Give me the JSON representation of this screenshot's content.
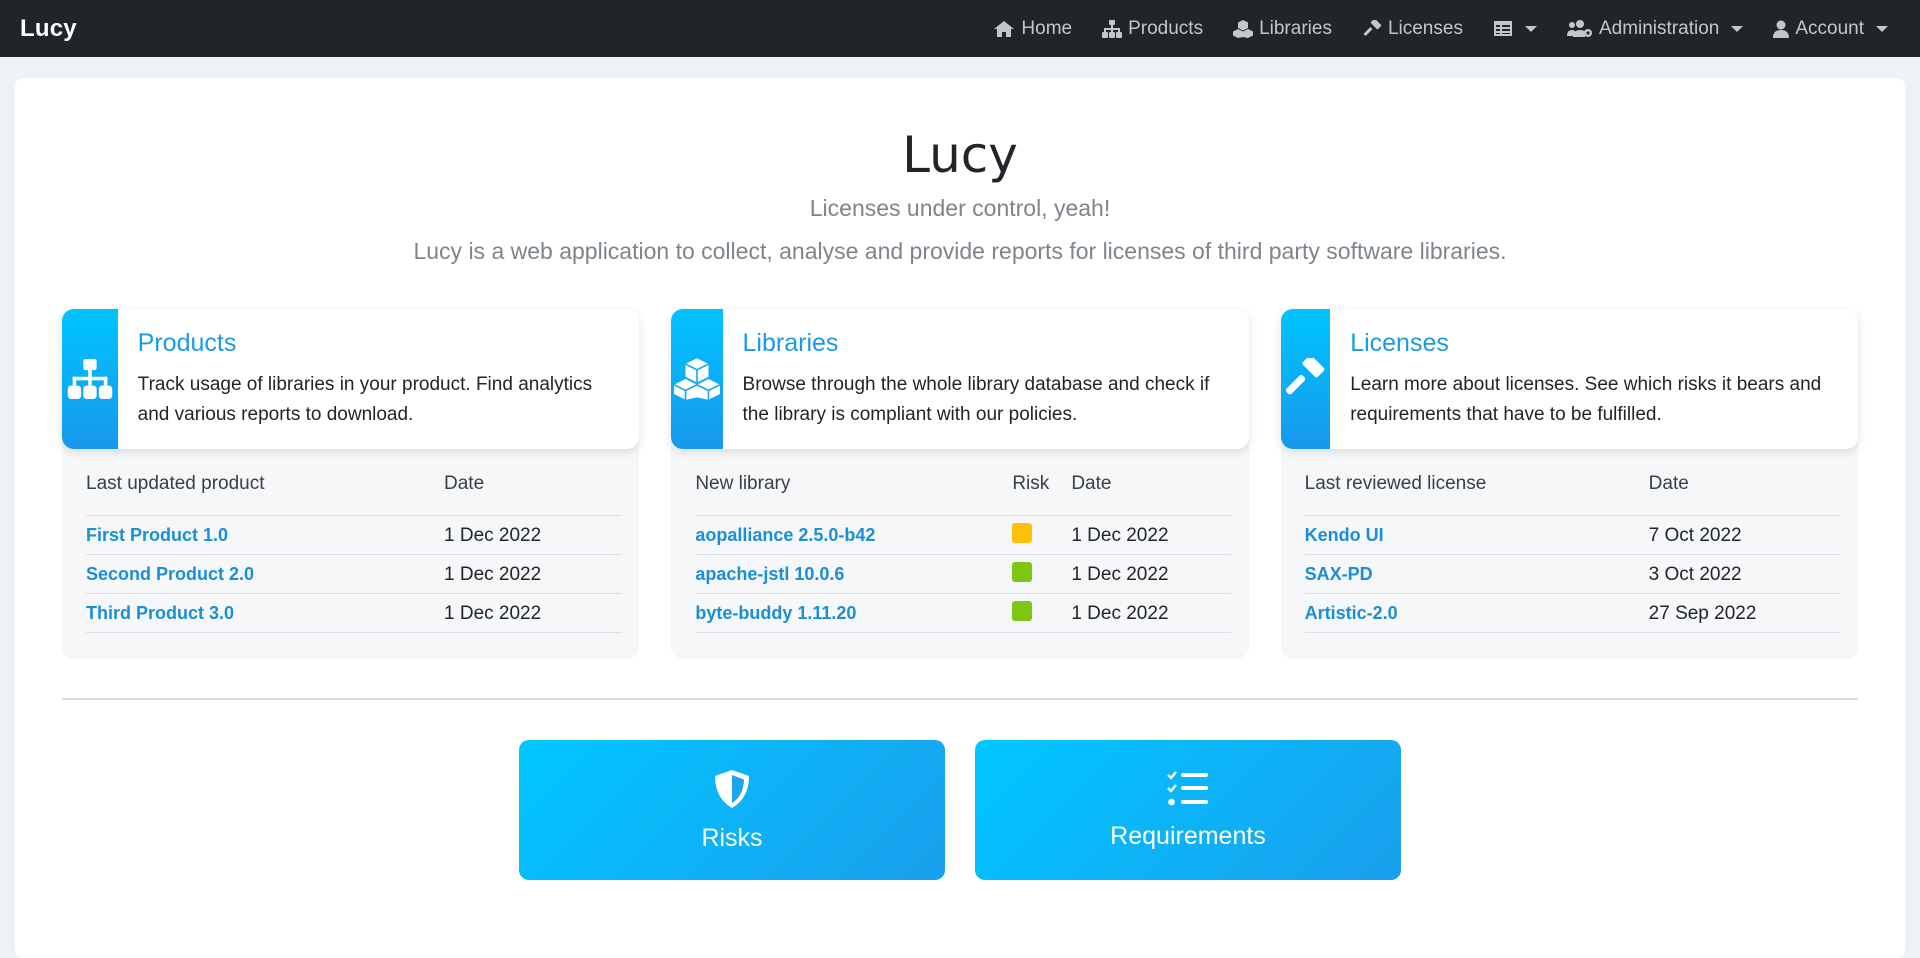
{
  "navbar": {
    "brand": "Lucy",
    "items": [
      {
        "label": "Home",
        "icon": "home-icon"
      },
      {
        "label": "Products",
        "icon": "sitemap-icon"
      },
      {
        "label": "Libraries",
        "icon": "cubes-icon"
      },
      {
        "label": "Licenses",
        "icon": "gavel-icon"
      },
      {
        "label": "",
        "icon": "table-icon",
        "dropdown": true
      },
      {
        "label": "Administration",
        "icon": "users-cog-icon",
        "dropdown": true
      },
      {
        "label": "Account",
        "icon": "user-icon",
        "dropdown": true
      }
    ]
  },
  "hero": {
    "title": "Lucy",
    "tagline": "Licenses under control, yeah!",
    "description": "Lucy is a web application to collect, analyse and provide reports for licenses of third party software libraries."
  },
  "cards": {
    "products": {
      "title": "Products",
      "description": "Track usage of libraries in your product. Find analytics and various reports to download.",
      "col1": "Last updated product",
      "col2": "Date",
      "rows": [
        {
          "name": "First Product 1.0",
          "date": "1 Dec 2022"
        },
        {
          "name": "Second Product 2.0",
          "date": "1 Dec 2022"
        },
        {
          "name": "Third Product 3.0",
          "date": "1 Dec 2022"
        }
      ]
    },
    "libraries": {
      "title": "Libraries",
      "description": "Browse through the whole library database and check if the library is compliant with our policies.",
      "col1": "New library",
      "col_risk": "Risk",
      "col2": "Date",
      "rows": [
        {
          "name": "aopalliance 2.5.0-b42",
          "risk_color": "#ffc107",
          "date": "1 Dec 2022"
        },
        {
          "name": "apache-jstl 10.0.6",
          "risk_color": "#7ec614",
          "date": "1 Dec 2022"
        },
        {
          "name": "byte-buddy 1.11.20",
          "risk_color": "#7ec614",
          "date": "1 Dec 2022"
        }
      ]
    },
    "licenses": {
      "title": "Licenses",
      "description": "Learn more about licenses. See which risks it bears and requirements that have to be fulfilled.",
      "col1": "Last reviewed license",
      "col2": "Date",
      "rows": [
        {
          "name": "Kendo UI",
          "date": "7 Oct 2022"
        },
        {
          "name": "SAX-PD",
          "date": "3 Oct 2022"
        },
        {
          "name": "Artistic-2.0",
          "date": "27 Sep 2022"
        }
      ]
    }
  },
  "buttons": {
    "risks": {
      "label": "Risks",
      "icon": "shield-icon"
    },
    "requirements": {
      "label": "Requirements",
      "icon": "tasks-icon"
    }
  },
  "colors": {
    "accent": "#1a9be6",
    "navbar": "#212529",
    "risk_medium": "#ffc107",
    "risk_low": "#7ec614"
  }
}
